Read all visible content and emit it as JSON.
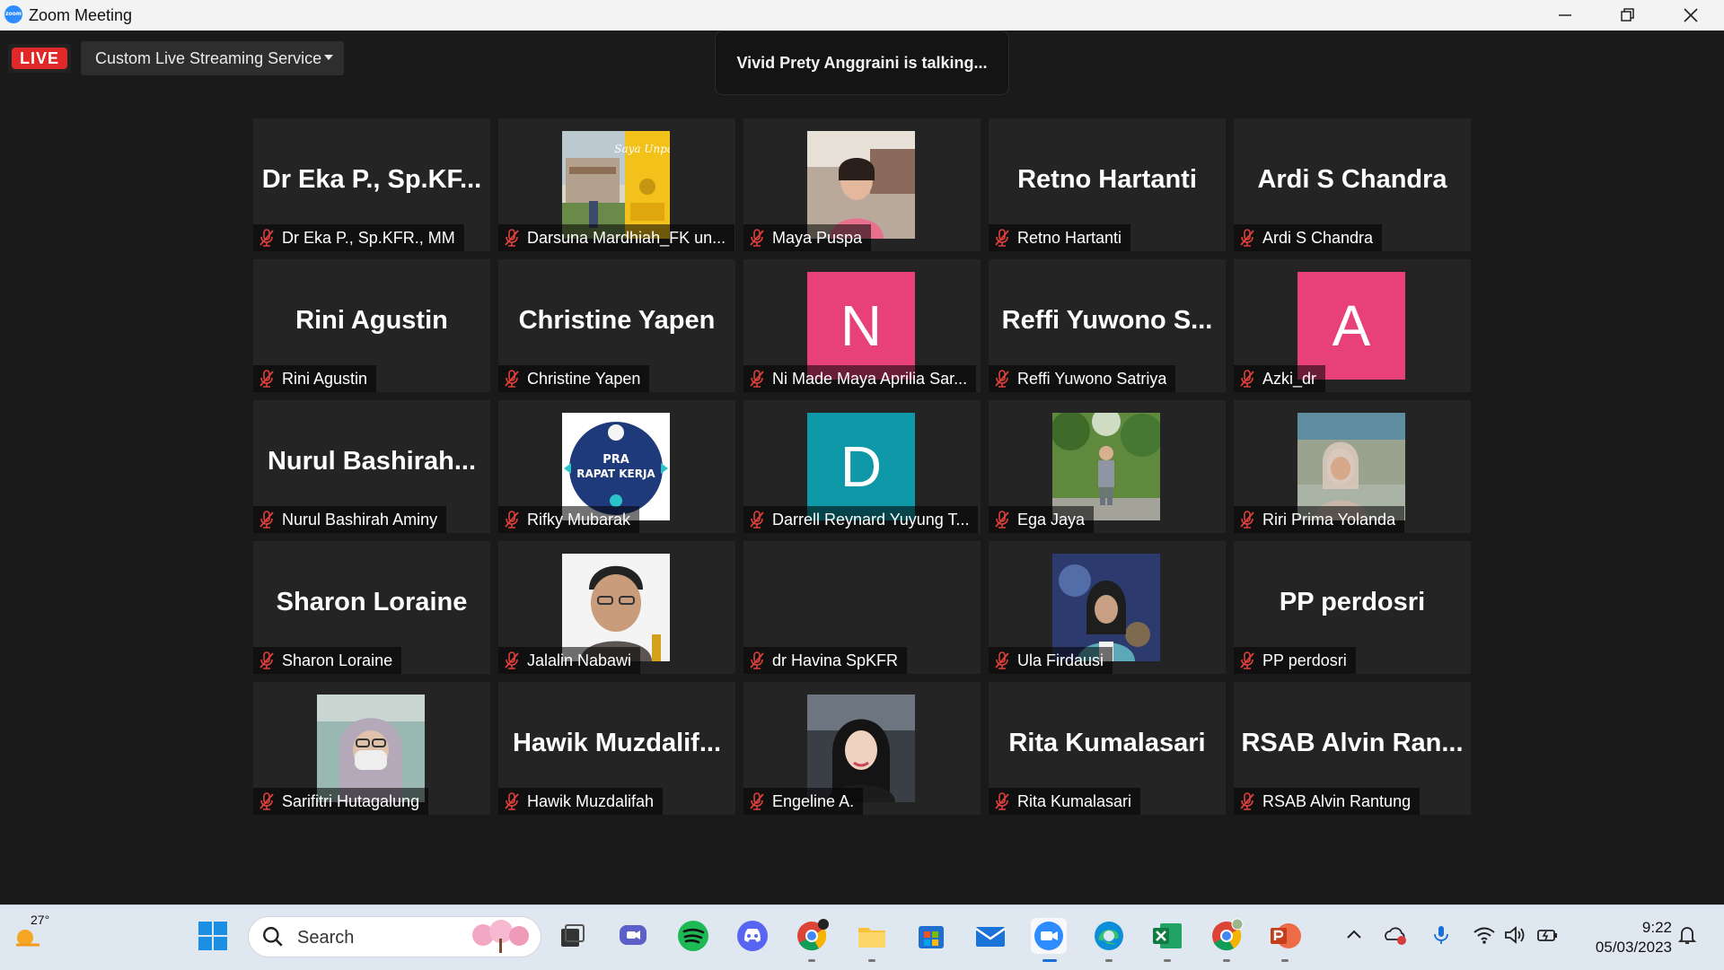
{
  "window": {
    "title": "Zoom Meeting",
    "logo_text": "zoom"
  },
  "controls": {
    "live_label": "LIVE",
    "stream_service": "Custom Live Streaming Service"
  },
  "talking_banner": "Vivid Prety Anggraini is talking...",
  "participants": [
    {
      "big": "Dr Eka P., Sp.KF...",
      "name": "Dr Eka P., Sp.KFR., MM"
    },
    {
      "big": "",
      "name": "Darsuna Mardhiah_FK un..."
    },
    {
      "big": "",
      "name": "Maya Puspa"
    },
    {
      "big": "Retno Hartanti",
      "name": "Retno Hartanti"
    },
    {
      "big": "Ardi S Chandra",
      "name": "Ardi S Chandra"
    },
    {
      "big": "Rini Agustin",
      "name": "Rini Agustin"
    },
    {
      "big": "Christine Yapen",
      "name": "Christine Yapen"
    },
    {
      "big": "N",
      "name": "Ni Made Maya Aprilia Sar..."
    },
    {
      "big": "Reffi Yuwono S...",
      "name": "Reffi Yuwono Satriya"
    },
    {
      "big": "A",
      "name": "Azki_dr"
    },
    {
      "big": "Nurul  Bashirah...",
      "name": "Nurul Bashirah Aminy"
    },
    {
      "big": "",
      "name": "Rifky Mubarak"
    },
    {
      "big": "D",
      "name": "Darrell Reynard Yuyung T..."
    },
    {
      "big": "",
      "name": "Ega Jaya"
    },
    {
      "big": "",
      "name": "Riri Prima Yolanda"
    },
    {
      "big": "Sharon Loraine",
      "name": "Sharon Loraine"
    },
    {
      "big": "",
      "name": "Jalalin Nabawi"
    },
    {
      "big": "",
      "name": "dr Havina SpKFR"
    },
    {
      "big": "",
      "name": "Ula Firdausi"
    },
    {
      "big": "PP perdosri",
      "name": "PP perdosri"
    },
    {
      "big": "",
      "name": "Sarifitri Hutagalung"
    },
    {
      "big": "Hawik  Muzdalif...",
      "name": "Hawik Muzdalifah"
    },
    {
      "big": "",
      "name": "Engeline A."
    },
    {
      "big": "Rita Kumalasari",
      "name": "Rita Kumalasari"
    },
    {
      "big": "RSAB  Alvin  Ran...",
      "name": "RSAB Alvin Rantung"
    }
  ],
  "picture_text": {
    "darsuna": "Saya Unpad",
    "rifky_line1": "PRA",
    "rifky_line2": "RAPAT KERJA"
  },
  "colors": {
    "avatar_pink": "#e8417a",
    "avatar_teal": "#0e98a8",
    "muted_mic": "#e0403a",
    "live_red": "#e02828",
    "zoom_blue": "#2d8cff"
  },
  "taskbar": {
    "weather_temp": "27°",
    "search_placeholder": "Search",
    "time": "9:22",
    "date": "05/03/2023"
  }
}
